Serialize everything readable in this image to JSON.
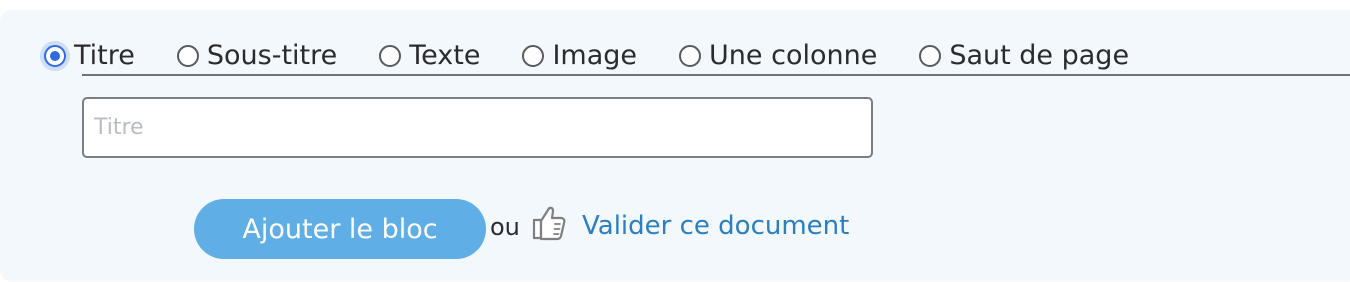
{
  "block_types": {
    "options": [
      {
        "label": "Titre",
        "selected": true
      },
      {
        "label": "Sous-titre",
        "selected": false
      },
      {
        "label": "Texte",
        "selected": false
      },
      {
        "label": "Image",
        "selected": false
      },
      {
        "label": "Une colonne",
        "selected": false
      },
      {
        "label": "Saut de page",
        "selected": false
      }
    ]
  },
  "title_field": {
    "placeholder": "Titre",
    "value": ""
  },
  "actions": {
    "add_block_label": "Ajouter le bloc",
    "or_text": "ou",
    "thumb_icon": "thumbs-up-icon",
    "validate_label": "Valider ce document"
  },
  "colors": {
    "panel_background": "#f3f8fc",
    "accent_blue": "#2f6ae0",
    "button_blue": "#5faee6",
    "link_blue": "#2b7fc0"
  }
}
